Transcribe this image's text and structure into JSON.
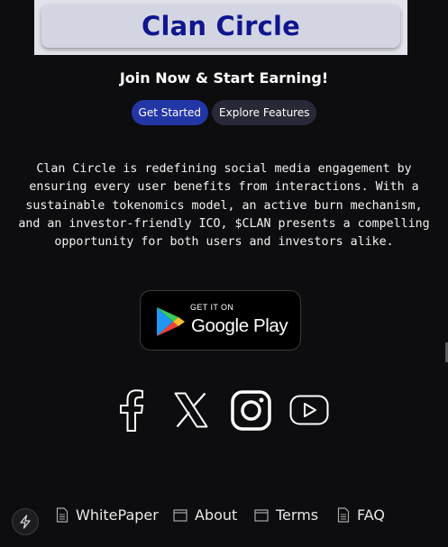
{
  "header": {
    "title": "Clan Circle"
  },
  "hero": {
    "tagline": "Join Now & Start Earning!",
    "primary_button": "Get Started",
    "secondary_button": "Explore Features",
    "description": "Clan Circle is redefining social media engagement by ensuring every user benefits from interactions. With a sustainable tokenomics model, an active burn mechanism, and an investor-friendly ICO, $CLAN presents a compelling opportunity for both users and investors alike."
  },
  "store_badge": {
    "small_text": "GET IT ON",
    "big_text": "Google Play",
    "icon": "google-play-icon"
  },
  "social": [
    "facebook-icon",
    "x-icon",
    "instagram-icon",
    "youtube-icon"
  ],
  "footer": {
    "items": [
      {
        "label": "WhitePaper",
        "icon": "document-icon"
      },
      {
        "label": "About",
        "icon": "window-icon"
      },
      {
        "label": "Terms",
        "icon": "window-icon"
      },
      {
        "label": "FAQ",
        "icon": "document-icon"
      }
    ],
    "action_icon": "lightning-icon"
  },
  "colors": {
    "background": "#0d0d0f",
    "title": "#10168f",
    "primary_button": "#2336a6",
    "secondary_button": "#272a36"
  }
}
